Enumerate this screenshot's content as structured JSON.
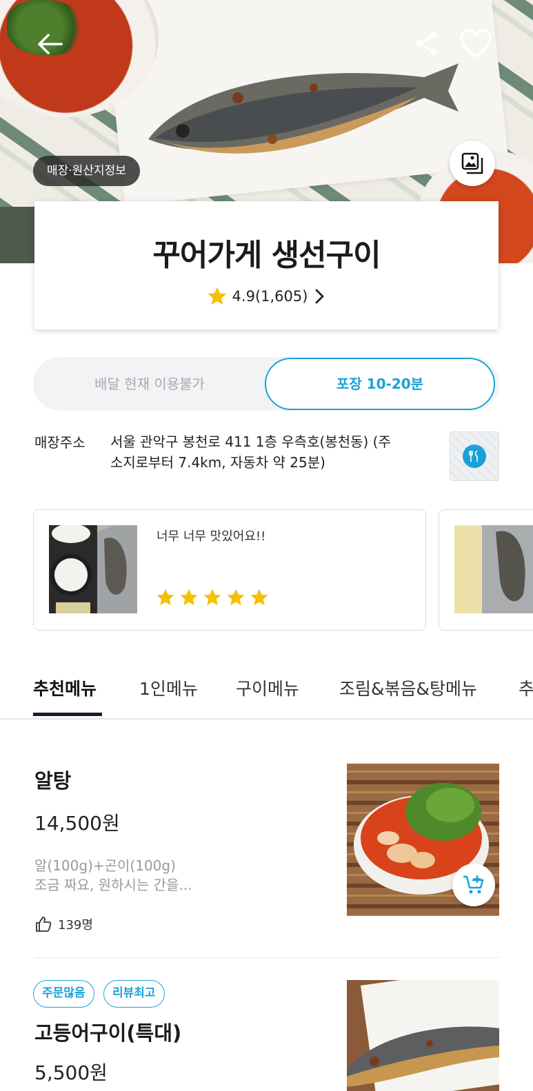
{
  "hero": {
    "origin_badge": "매장·원산지정보",
    "icons": {
      "back": "arrow-left-icon",
      "share": "share-icon",
      "like": "heart-icon",
      "gallery": "image-gallery-icon"
    }
  },
  "store": {
    "name": "꾸어가게 생선구이",
    "rating": "4.9(1,605)"
  },
  "order_mode": {
    "delivery_label": "배달 현재 이용불가",
    "pickup_label": "포장 10-20분",
    "selected": "pickup",
    "accent": "#1aa2d8"
  },
  "address": {
    "label": "매장주소",
    "line1": "서울 관악구 봉천로 411 1층 우측호(봉천동) (주",
    "line2": "소지로부터 7.4km, 자동차 약 25분)"
  },
  "reviews": [
    {
      "text": "너무 너무 맛있어요!!",
      "stars": 5
    }
  ],
  "tabs": [
    "추천메뉴",
    "1인메뉴",
    "구이메뉴",
    "조림&볶음&탕메뉴",
    "추"
  ],
  "menu": [
    {
      "name": "알탕",
      "price": "14,500원",
      "desc_line1": "알(100g)+곤이(100g)",
      "desc_line2": "조금 짜요, 원하시는 간을...",
      "likes": "139명"
    },
    {
      "badges": [
        "주문많음",
        "리뷰최고"
      ],
      "name": "고등어구이(특대)",
      "price": "5,500원"
    }
  ]
}
